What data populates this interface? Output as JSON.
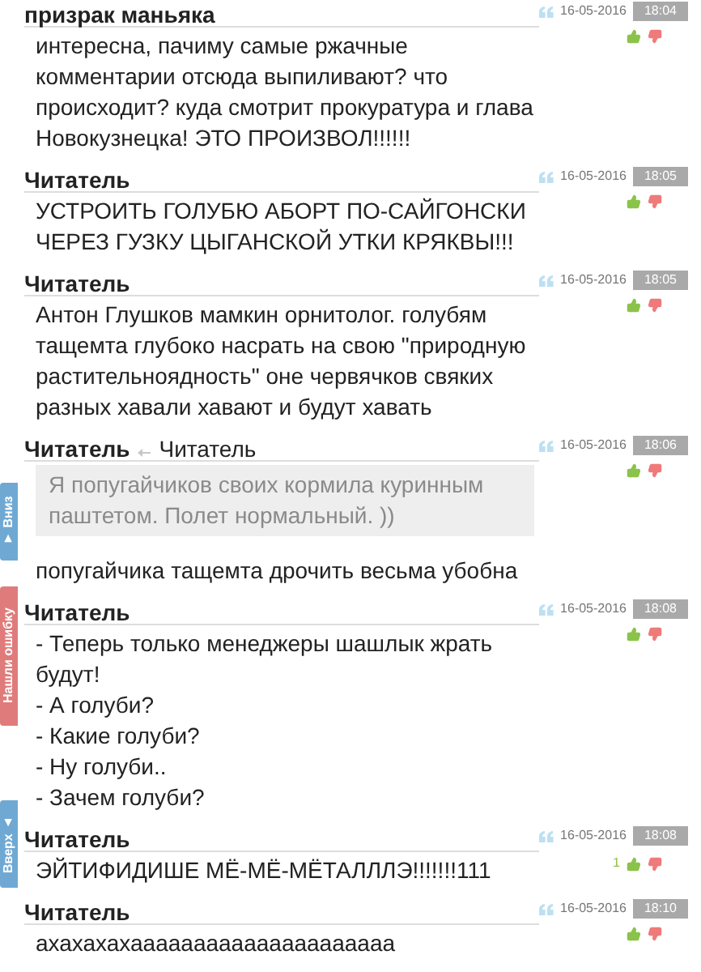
{
  "comments": [
    {
      "author": "призрак маньяка",
      "date": "16-05-2016",
      "time": "18:04",
      "body": "интересна, пачиму самые ржачные комментарии отсюда выпиливают? что происходит? куда смотрит прокуратура и глава Новокузнецка! ЭТО ПРОИЗВОЛ!!!!!!"
    },
    {
      "author": "Читатель",
      "date": "16-05-2016",
      "time": "18:05",
      "body": "УСТРОИТЬ ГОЛУБЮ АБОРТ ПО-САЙГОНСКИ ЧЕРЕЗ ГУЗКУ ЦЫГАНСКОЙ УТКИ КРЯКВЫ!!!"
    },
    {
      "author": "Читатель",
      "date": "16-05-2016",
      "time": "18:05",
      "body": "Антон Глушков мамкин орнитолог. голубям тащемта глубоко насрать на свою \"природную растительноядность\" оне червячков свяких разных хавали хавают и будут хавать"
    },
    {
      "author": "Читатель",
      "reply_to": "Читатель",
      "date": "16-05-2016",
      "time": "18:06",
      "quote": "Я попугайчиков своих кормила куринным паштетом. Полет нормальный. ))",
      "body": "попугайчика тащемта дрочить весьма убобна"
    },
    {
      "author": "Читатель",
      "date": "16-05-2016",
      "time": "18:08",
      "body": "- Теперь только менеджеры шашлык жрать будут!\n- А голуби?\n- Какие голуби?\n- Ну голуби..\n- Зачем голуби?"
    },
    {
      "author": "Читатель",
      "date": "16-05-2016",
      "time": "18:08",
      "likes": "1",
      "body": "ЭЙТИФИДИШЕ МЁ-МЁ-МЁТАЛЛЛЭ!!!!!!!111"
    },
    {
      "author": "Читатель",
      "date": "16-05-2016",
      "time": "18:10",
      "body": "ахахахахааааааааааааааааааааа"
    }
  ],
  "side_tabs": [
    {
      "kind": "down",
      "label": "▼ Вниз"
    },
    {
      "kind": "error",
      "label": "Нашли ошибку"
    },
    {
      "kind": "up",
      "label": "Вверх ▲"
    }
  ]
}
